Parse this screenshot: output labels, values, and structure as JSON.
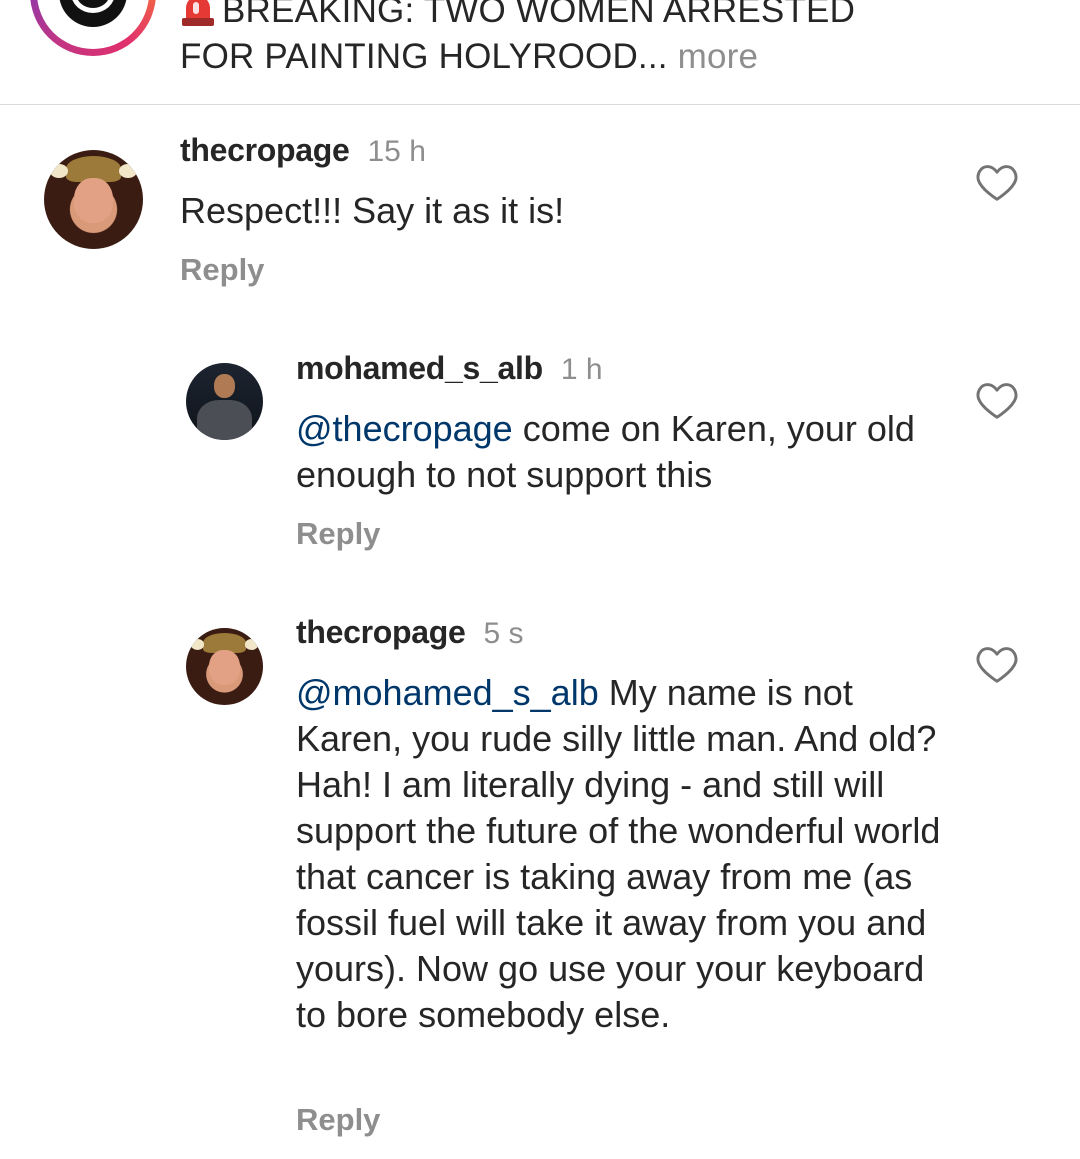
{
  "post": {
    "caption_icon": "police-siren-emoji",
    "caption_line1": "BREAKING: TWO WOMEN ARRESTED",
    "caption_line2": "FOR PAINTING HOLYROOD...",
    "more_label": " more"
  },
  "comments": [
    {
      "username": "thecropage",
      "time": "15 h",
      "mention": "",
      "text": "Respect!!! Say it as it is!",
      "reply_label": "Reply"
    },
    {
      "username": "mohamed_s_alb",
      "time": "1 h",
      "mention": "@thecropage",
      "text": "come on Karen, your old enough to not support this",
      "reply_label": "Reply"
    },
    {
      "username": "thecropage",
      "time": "5 s",
      "mention": "@mohamed_s_alb",
      "text": "My name is not Karen, you rude silly little man. And old? Hah! I am literally dying - and still will support the future of the wonderful world that cancer is taking away from me (as fossil fuel will take it away from you and yours). Now go use your your keyboard to bore somebody else.",
      "reply_label": "Reply"
    }
  ],
  "colors": {
    "mention": "#00376b",
    "muted": "#8e8e8e",
    "text": "#262626"
  }
}
